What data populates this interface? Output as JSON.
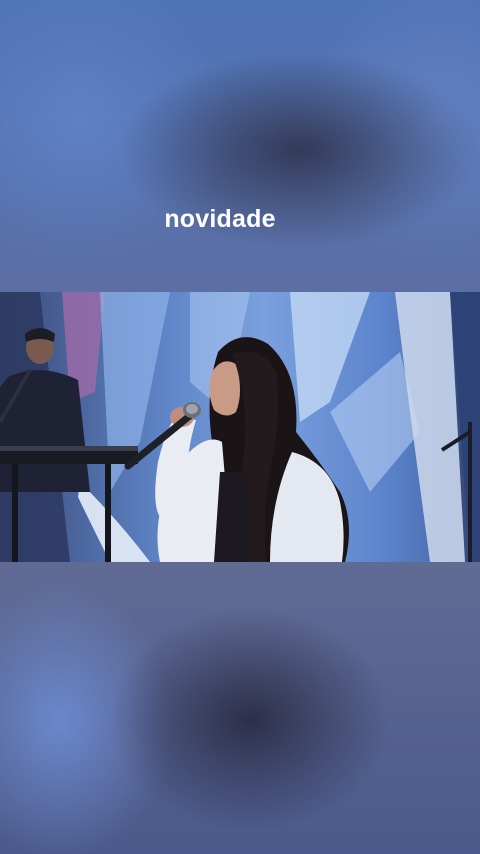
{
  "overlay": {
    "caption": "novidade"
  },
  "video": {
    "scene": "singer-with-microphone-on-stage"
  },
  "colors": {
    "backdrop_blue": "#4f74b8",
    "stage_light": "#7aa0dd",
    "caption_text": "#ffffff"
  }
}
